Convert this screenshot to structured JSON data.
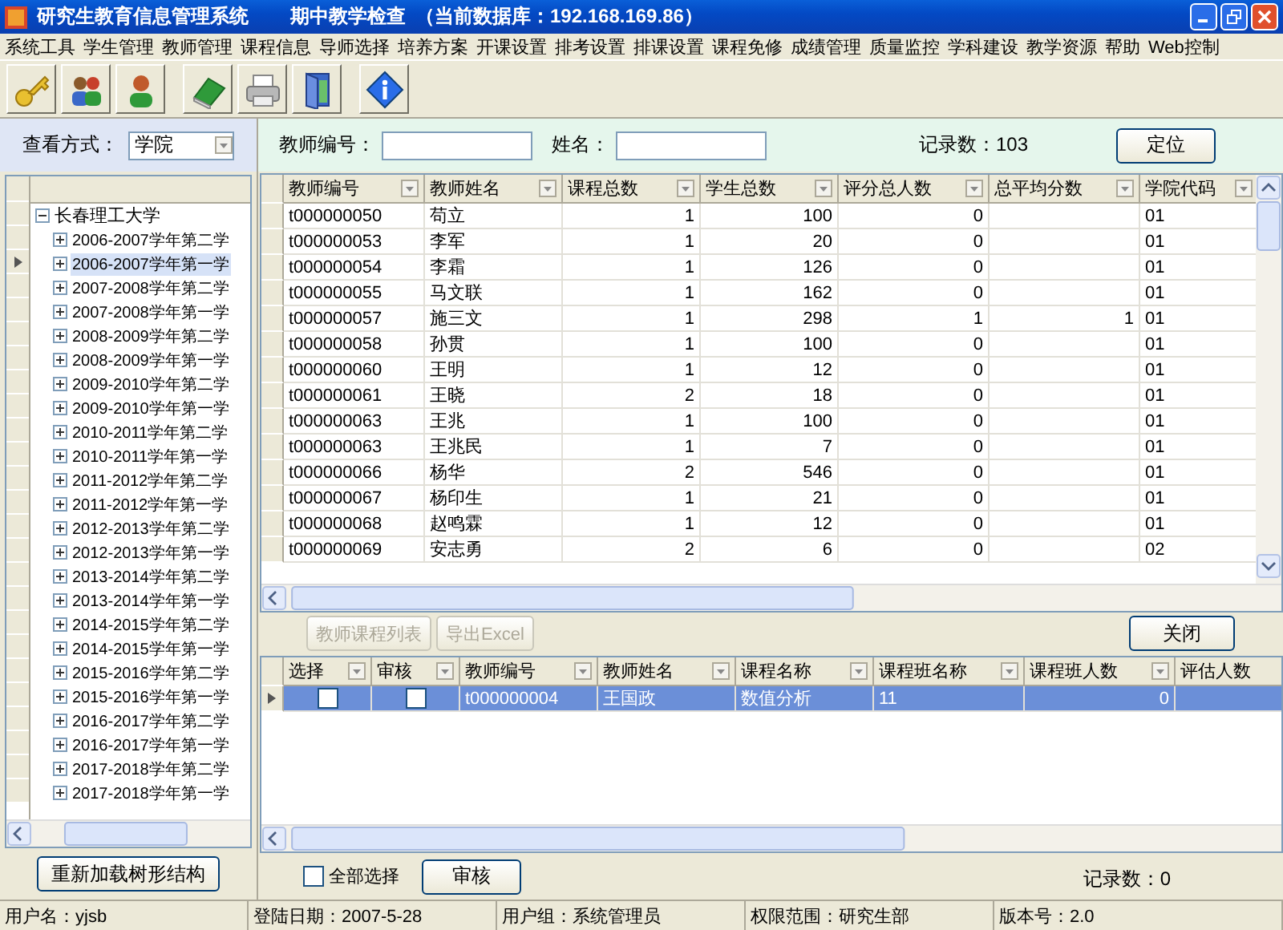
{
  "window": {
    "title": "研究生教育信息管理系统",
    "subtitle": "期中教学检查",
    "database": "（当前数据库：192.168.169.86）"
  },
  "menu": [
    "系统工具",
    "学生管理",
    "教师管理",
    "课程信息",
    "导师选择",
    "培养方案",
    "开课设置",
    "排考设置",
    "排课设置",
    "课程免修",
    "成绩管理",
    "质量监控",
    "学科建设",
    "教学资源",
    "帮助",
    "Web控制"
  ],
  "view_mode": {
    "label": "查看方式：",
    "value": "学院"
  },
  "tree": {
    "label": "长春理工大学",
    "expanded": true,
    "children": [
      {
        "label": "2006-2007学年第二学",
        "expanded": false,
        "selected": false
      },
      {
        "label": "2006-2007学年第一学",
        "expanded": false,
        "selected": true
      },
      {
        "label": "2007-2008学年第二学",
        "expanded": false,
        "selected": false
      },
      {
        "label": "2007-2008学年第一学",
        "expanded": false,
        "selected": false
      },
      {
        "label": "2008-2009学年第二学",
        "expanded": false,
        "selected": false
      },
      {
        "label": "2008-2009学年第一学",
        "expanded": false,
        "selected": false
      },
      {
        "label": "2009-2010学年第二学",
        "expanded": false,
        "selected": false
      },
      {
        "label": "2009-2010学年第一学",
        "expanded": false,
        "selected": false
      },
      {
        "label": "2010-2011学年第二学",
        "expanded": false,
        "selected": false
      },
      {
        "label": "2010-2011学年第一学",
        "expanded": false,
        "selected": false
      },
      {
        "label": "2011-2012学年第二学",
        "expanded": false,
        "selected": false
      },
      {
        "label": "2011-2012学年第一学",
        "expanded": false,
        "selected": false
      },
      {
        "label": "2012-2013学年第二学",
        "expanded": false,
        "selected": false
      },
      {
        "label": "2012-2013学年第一学",
        "expanded": false,
        "selected": false
      },
      {
        "label": "2013-2014学年第二学",
        "expanded": false,
        "selected": false
      },
      {
        "label": "2013-2014学年第一学",
        "expanded": false,
        "selected": false
      },
      {
        "label": "2014-2015学年第二学",
        "expanded": false,
        "selected": false
      },
      {
        "label": "2014-2015学年第一学",
        "expanded": false,
        "selected": false
      },
      {
        "label": "2015-2016学年第二学",
        "expanded": false,
        "selected": false
      },
      {
        "label": "2015-2016学年第一学",
        "expanded": false,
        "selected": false
      },
      {
        "label": "2016-2017学年第二学",
        "expanded": false,
        "selected": false
      },
      {
        "label": "2016-2017学年第一学",
        "expanded": false,
        "selected": false
      },
      {
        "label": "2017-2018学年第二学",
        "expanded": false,
        "selected": false
      },
      {
        "label": "2017-2018学年第一学",
        "expanded": false,
        "selected": false
      }
    ]
  },
  "reload_button": "重新加载树形结构",
  "search_fields": [
    {
      "label": "教师编号："
    },
    {
      "label": "姓名："
    }
  ],
  "record_count": "记录数：103",
  "locate_button": "定位",
  "teacher_table": {
    "columns": [
      {
        "label": "教师编号",
        "kind": "text"
      },
      {
        "label": "教师姓名",
        "kind": "text"
      },
      {
        "label": "课程总数",
        "kind": "number"
      },
      {
        "label": "学生总数",
        "kind": "number"
      },
      {
        "label": "评分总人数",
        "kind": "number"
      },
      {
        "label": "总平均分数",
        "kind": "number"
      },
      {
        "label": "学院代码",
        "kind": "text"
      }
    ],
    "rows": [
      [
        "t000000050",
        "苟立",
        "1",
        "100",
        "0",
        "",
        "01"
      ],
      [
        "t000000053",
        "李军",
        "1",
        "20",
        "0",
        "",
        "01"
      ],
      [
        "t000000054",
        "李霜",
        "1",
        "126",
        "0",
        "",
        "01"
      ],
      [
        "t000000055",
        "马文联",
        "1",
        "162",
        "0",
        "",
        "01"
      ],
      [
        "t000000057",
        "施三文",
        "1",
        "298",
        "1",
        "1",
        "01"
      ],
      [
        "t000000058",
        "孙贯",
        "1",
        "100",
        "0",
        "",
        "01"
      ],
      [
        "t000000060",
        "王明",
        "1",
        "12",
        "0",
        "",
        "01"
      ],
      [
        "t000000061",
        "王晓",
        "2",
        "18",
        "0",
        "",
        "01"
      ],
      [
        "t000000063",
        "王兆",
        "1",
        "100",
        "0",
        "",
        "01"
      ],
      [
        "t000000063",
        "王兆民",
        "1",
        "7",
        "0",
        "",
        "01"
      ],
      [
        "t000000066",
        "杨华",
        "2",
        "546",
        "0",
        "",
        "01"
      ],
      [
        "t000000067",
        "杨印生",
        "1",
        "21",
        "0",
        "",
        "01"
      ],
      [
        "t000000068",
        "赵鸣霖",
        "1",
        "12",
        "0",
        "",
        "01"
      ],
      [
        "t000000069",
        "安志勇",
        "2",
        "6",
        "0",
        "",
        "02"
      ]
    ]
  },
  "action_buttons": [
    {
      "label": "教师课程列表",
      "disabled": true
    },
    {
      "label": "导出Excel",
      "disabled": true
    }
  ],
  "close_button": "关闭",
  "course_table": {
    "columns": [
      {
        "label": "选择",
        "kind": "check"
      },
      {
        "label": "审核",
        "kind": "check"
      },
      {
        "label": "教师编号",
        "kind": "text"
      },
      {
        "label": "教师姓名",
        "kind": "text"
      },
      {
        "label": "课程名称",
        "kind": "text"
      },
      {
        "label": "课程班名称",
        "kind": "text"
      },
      {
        "label": "课程班人数",
        "kind": "number"
      },
      {
        "label": "评估人数",
        "kind": "number"
      }
    ],
    "rows": [
      {
        "selected": true,
        "cells": [
          {
            "checked": false
          },
          {
            "checked": false
          },
          {
            "text": "t000000004"
          },
          {
            "text": "王国政"
          },
          {
            "text": "数值分析"
          },
          {
            "text": "11"
          },
          {
            "text": "0"
          },
          {}
        ]
      }
    ]
  },
  "select_all": {
    "label": "全部选择",
    "checked": false
  },
  "approve_button": "审核",
  "course_record_count": "记录数：0",
  "status_bar": [
    "用户名：yjsb",
    "登陆日期：2007-5-28",
    "用户组：系统管理员",
    "权限范围：研究生部",
    "版本号：2.0"
  ]
}
